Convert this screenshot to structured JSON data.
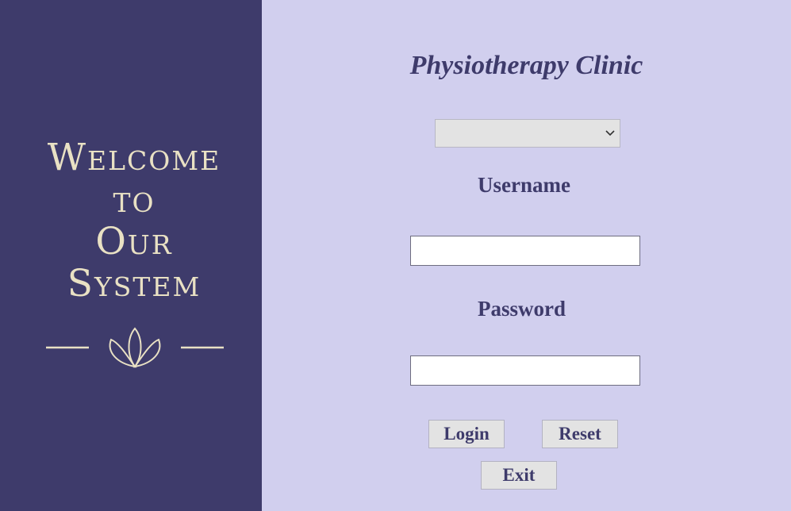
{
  "welcome": {
    "lines": [
      "Welcome",
      "to",
      "Our",
      "System"
    ]
  },
  "ornament": {
    "icon": "lotus-icon"
  },
  "form": {
    "title": "Physiotherapy Clinic",
    "role_select": {
      "selected": "",
      "icon": "chevron-down-icon"
    },
    "username_label": "Username",
    "username_value": "",
    "password_label": "Password",
    "password_value": ""
  },
  "buttons": {
    "login": "Login",
    "reset": "Reset",
    "exit": "Exit"
  },
  "colors": {
    "panel": "#3e3b6b",
    "background": "#d1cfee",
    "accent_text": "#e9e1c4"
  }
}
